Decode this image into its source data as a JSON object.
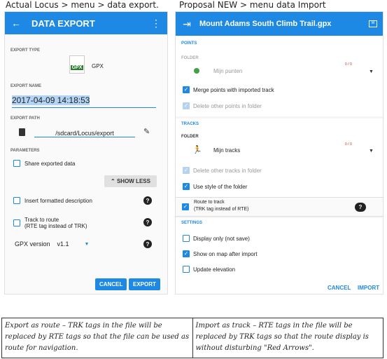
{
  "captions": {
    "left": "Actual Locus > menu > data export.",
    "right": "Proposal NEW > menu data Import"
  },
  "export_screen": {
    "title": "DATA EXPORT",
    "back_icon": "arrow-left-icon",
    "more_icon": "more-vert-icon",
    "export_type_label": "EXPORT TYPE",
    "export_type_value": "GPX",
    "file_badge": "GPX",
    "export_name_label": "EXPORT NAME",
    "export_name_value": "2017-04-09 14:18:53",
    "export_path_label": "EXPORT PATH",
    "export_path_value": "/sdcard/Locus/export",
    "parameters_label": "PARAMETERS",
    "share_label": "Share exported data",
    "show_less_label": "SHOW LESS",
    "insert_desc_label": "Insert formatted description",
    "track_to_route_label": "Track to route",
    "track_to_route_sub": "(RTE tag instead of TRK)",
    "gpx_version_label": "GPX version",
    "gpx_version_value": "v1.1",
    "cancel_label": "CANCEL",
    "export_label": "EXPORT"
  },
  "import_screen": {
    "title": "Mount Adams South Climb Trail.gpx",
    "points_label": "POINTS",
    "folder_label": "FOLDER",
    "points_folder_value": "Mijn punten",
    "points_count": "0 / 0",
    "merge_label": "Merge points with imported track",
    "delete_points_label": "Delete other points in folder",
    "tracks_label": "TRACKS",
    "tracks_folder_label": "FOLDER",
    "tracks_folder_value": "Mijn tracks",
    "tracks_count": "0 / 0",
    "delete_tracks_label": "Delete other tracks in folder",
    "use_style_label": "Use style of the folder",
    "route_to_track_label": "Route to track",
    "route_to_track_sub": "(TRK tag instead of RTE)",
    "settings_label": "SETTINGS",
    "display_only_label": "Display only (not save)",
    "show_on_map_label": "Show on map after import",
    "update_elevation_label": "Update elevation",
    "cancel_label": "CANCEL",
    "import_label": "IMPORT"
  },
  "notes": {
    "left": "Export as route – TRK tags in the file will be replaced by RTE tags so that the file can be used as route for navigation.",
    "right": "Import as track – RTE tags in the file will be replaced by TRK tags so that the route display is without disturbing \"Red Arrows\"."
  },
  "colors": {
    "accent": "#1e88e5",
    "red_count": "#d32f2f",
    "green_dot": "#43a047"
  }
}
